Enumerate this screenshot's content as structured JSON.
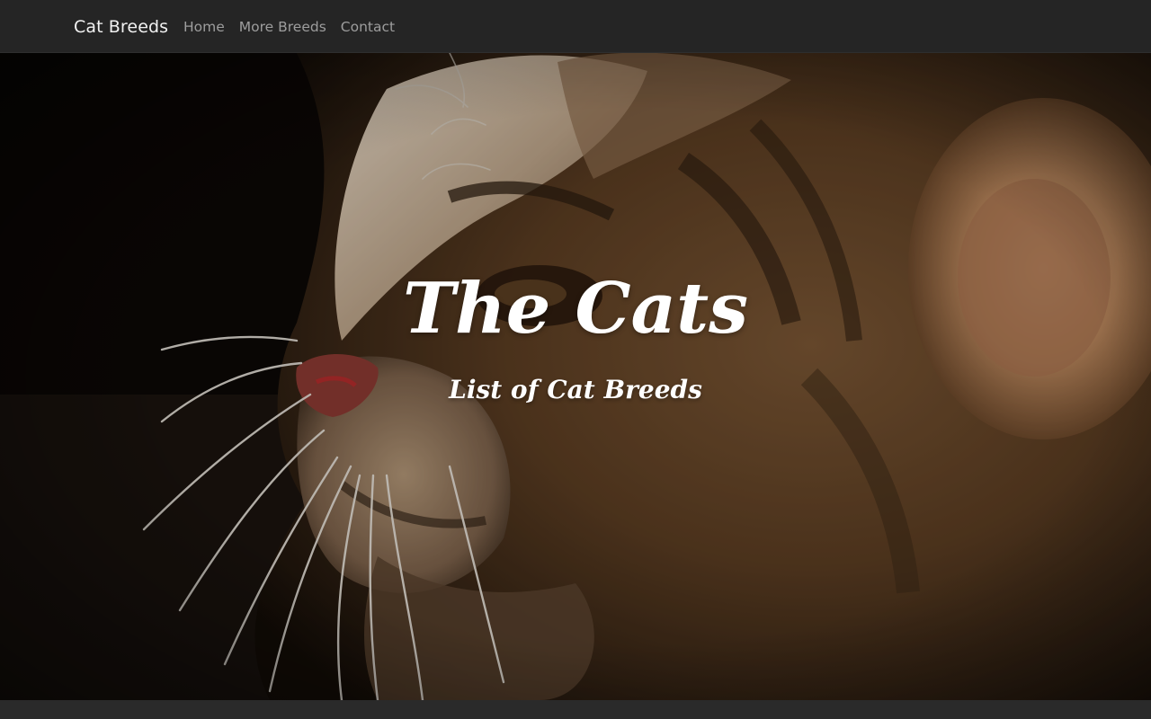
{
  "navbar": {
    "brand": "Cat Breeds",
    "links": [
      {
        "label": "Home"
      },
      {
        "label": "More Breeds"
      },
      {
        "label": "Contact"
      }
    ]
  },
  "hero": {
    "title": "The Cats",
    "subtitle": "List of Cat Breeds",
    "background_image": "kitten-closeup-photo"
  }
}
